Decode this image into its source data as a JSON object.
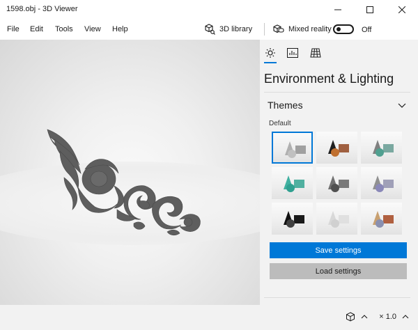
{
  "window": {
    "title": "1598.obj - 3D Viewer"
  },
  "menu": [
    "File",
    "Edit",
    "Tools",
    "View",
    "Help"
  ],
  "toolbar": {
    "library_label": "3D library",
    "mixed_reality_label": "Mixed reality",
    "toggle_state": "Off"
  },
  "panel": {
    "tabs": [
      "sun-icon",
      "stats-icon",
      "grid-icon"
    ],
    "title": "Environment & Lighting",
    "section_label": "Themes",
    "default_label": "Default",
    "themes": [
      {
        "selected": true,
        "cone": "#b0b0b0",
        "cube": "#a0a0a0",
        "sphere": "#c0c0c0"
      },
      {
        "selected": false,
        "cone": "#1f1f1f",
        "cube": "#a06040",
        "sphere": "#c07030"
      },
      {
        "selected": false,
        "cone": "#808080",
        "cube": "#7aa8a0",
        "sphere": "#50a090"
      },
      {
        "selected": false,
        "cone": "#40b0a0",
        "cube": "#50b0a0",
        "sphere": "#2fa090"
      },
      {
        "selected": false,
        "cone": "#707070",
        "cube": "#7a7a7a",
        "sphere": "#505050"
      },
      {
        "selected": false,
        "cone": "#909090",
        "cube": "#a0a0b8",
        "sphere": "#8a88b8"
      },
      {
        "selected": false,
        "cone": "#101010",
        "cube": "#1a1a1a",
        "sphere": "#404040"
      },
      {
        "selected": false,
        "cone": "#d8d8d8",
        "cube": "#e0e0e0",
        "sphere": "#d0d0d0"
      },
      {
        "selected": false,
        "cone": "#c8a070",
        "cube": "#b06040",
        "sphere": "#8a90b0"
      }
    ],
    "save_label": "Save settings",
    "load_label": "Load settings"
  },
  "status": {
    "zoom": "× 1.0"
  },
  "colors": {
    "accent": "#0078d7",
    "panel_bg": "#f2f2f2",
    "model": "#5e5e5e"
  }
}
